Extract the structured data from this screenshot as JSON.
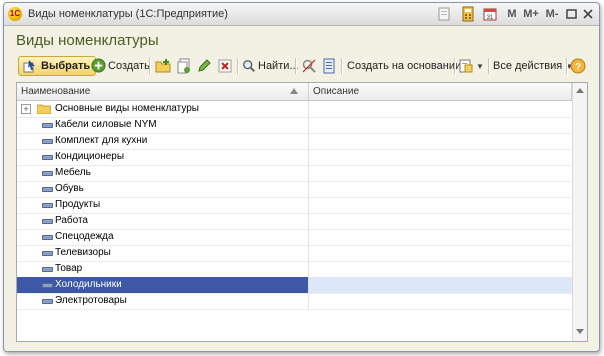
{
  "window": {
    "title": "Виды номенклатуры  (1С:Предприятие)",
    "m_label": "M",
    "m_plus_label": "M+",
    "m_minus_label": "M-"
  },
  "form": {
    "title": "Виды номенклатуры"
  },
  "toolbar": {
    "select_label": "Выбрать",
    "create_label": "Создать",
    "find_label": "Найти...",
    "create_based_label": "Создать на основании",
    "all_actions_label": "Все действия"
  },
  "table": {
    "columns": [
      "Наименование",
      "Описание"
    ],
    "group_row": "Основные виды номенклатуры",
    "rows": [
      "Кабели силовые NYM",
      "Комплект для кухни",
      "Кондиционеры",
      "Мебель",
      "Обувь",
      "Продукты",
      "Работа",
      "Спецодежда",
      "Телевизоры",
      "Товар",
      "Холодильники",
      "Электротовары"
    ],
    "selected_row": "Холодильники"
  },
  "colors": {
    "title_green": "#4a5d23",
    "selection_blue": "#3d58a5",
    "button_gold": "#f3d36a"
  }
}
